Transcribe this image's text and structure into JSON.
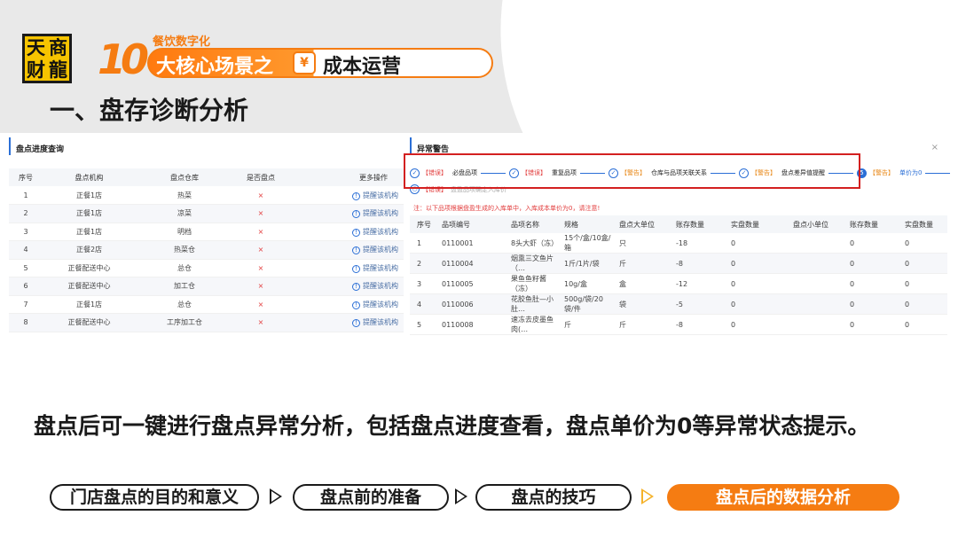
{
  "brand": {
    "logo_chars": [
      "天",
      "商",
      "财",
      "龍"
    ],
    "tagline_top": "餐饮数字化",
    "number": "10",
    "banner_left": "大核心场景之",
    "banner_icon": "¥",
    "banner_right": "成本运营"
  },
  "section_title": "一、盘存诊断分析",
  "progress_panel": {
    "title": "盘点进度查询",
    "columns": [
      "序号",
      "盘点机构",
      "盘点仓库",
      "是否盘点",
      "更多操作"
    ],
    "rows": [
      {
        "no": "1",
        "org": "正餐1店",
        "warehouse": "热菜",
        "done": "×",
        "action": "提醒该机构"
      },
      {
        "no": "2",
        "org": "正餐1店",
        "warehouse": "凉菜",
        "done": "×",
        "action": "提醒该机构"
      },
      {
        "no": "3",
        "org": "正餐1店",
        "warehouse": "明档",
        "done": "×",
        "action": "提醒该机构"
      },
      {
        "no": "4",
        "org": "正餐2店",
        "warehouse": "热菜仓",
        "done": "×",
        "action": "提醒该机构"
      },
      {
        "no": "5",
        "org": "正餐配送中心",
        "warehouse": "总仓",
        "done": "×",
        "action": "提醒该机构"
      },
      {
        "no": "6",
        "org": "正餐配送中心",
        "warehouse": "加工仓",
        "done": "×",
        "action": "提醒该机构"
      },
      {
        "no": "7",
        "org": "正餐1店",
        "warehouse": "总仓",
        "done": "×",
        "action": "提醒该机构"
      },
      {
        "no": "8",
        "org": "正餐配送中心",
        "warehouse": "工序加工仓",
        "done": "×",
        "action": "提醒该机构"
      }
    ]
  },
  "warning_panel": {
    "title": "异常警告",
    "close": "×",
    "steps": [
      {
        "tag": "【错误】",
        "tag_color": "red",
        "name": "必盘品项"
      },
      {
        "tag": "【错误】",
        "tag_color": "red",
        "name": "重复品项"
      },
      {
        "tag": "【警告】",
        "tag_color": "orange",
        "name": "仓库与品项关联关系"
      },
      {
        "tag": "【警告】",
        "tag_color": "orange",
        "name": "盘点差异值提醒"
      },
      {
        "tag": "【警告】",
        "tag_color": "orange",
        "name": "单价为0",
        "active": true,
        "number": "5"
      }
    ],
    "step2_tag": "【错误】",
    "step2_name": "盘盈品项确定入库价",
    "notice": "注：以下品项根据盘盈生成的入库单中，入库成本单价为0，请注意!",
    "columns": [
      "序号",
      "品项编号",
      "品项名称",
      "规格",
      "盘点大单位",
      "账存数量",
      "实盘数量",
      "盘点小单位",
      "账存数量",
      "实盘数量"
    ],
    "rows": [
      {
        "no": "1",
        "code": "0110001",
        "name": "8头大虾（冻）",
        "spec": "15个/盒/10盒/箱",
        "unit": "只",
        "book": "-18",
        "actual": "0",
        "small_unit": "",
        "book2": "0",
        "actual2": "0"
      },
      {
        "no": "2",
        "code": "0110004",
        "name": "烟熏三文鱼片（…",
        "spec": "1斤/1片/袋",
        "unit": "斤",
        "book": "-8",
        "actual": "0",
        "small_unit": "",
        "book2": "0",
        "actual2": "0"
      },
      {
        "no": "3",
        "code": "0110005",
        "name": "果鱼鱼籽酱（冻）",
        "spec": "10g/盒",
        "unit": "盒",
        "book": "-12",
        "actual": "0",
        "small_unit": "",
        "book2": "0",
        "actual2": "0"
      },
      {
        "no": "4",
        "code": "0110006",
        "name": "花胶鱼肚—小肚…",
        "spec": "500g/袋/20袋/件",
        "unit": "袋",
        "book": "-5",
        "actual": "0",
        "small_unit": "",
        "book2": "0",
        "actual2": "0"
      },
      {
        "no": "5",
        "code": "0110008",
        "name": "速冻去皮墨鱼肉(…",
        "spec": "斤",
        "unit": "斤",
        "book": "-8",
        "actual": "0",
        "small_unit": "",
        "book2": "0",
        "actual2": "0"
      }
    ]
  },
  "description": "盘点后可一键进行盘点异常分析，包括盘点进度查看，盘点单价为0等异常状态提示。",
  "nav": [
    {
      "label": "门店盘点的目的和意义",
      "active": false
    },
    {
      "label": "盘点前的准备",
      "active": false
    },
    {
      "label": "盘点的技巧",
      "active": false
    },
    {
      "label": "盘点后的数据分析",
      "active": true
    }
  ],
  "colors": {
    "accent": "#f57c12",
    "highlight_box": "#d32020",
    "link_blue": "#2b6fd6"
  }
}
